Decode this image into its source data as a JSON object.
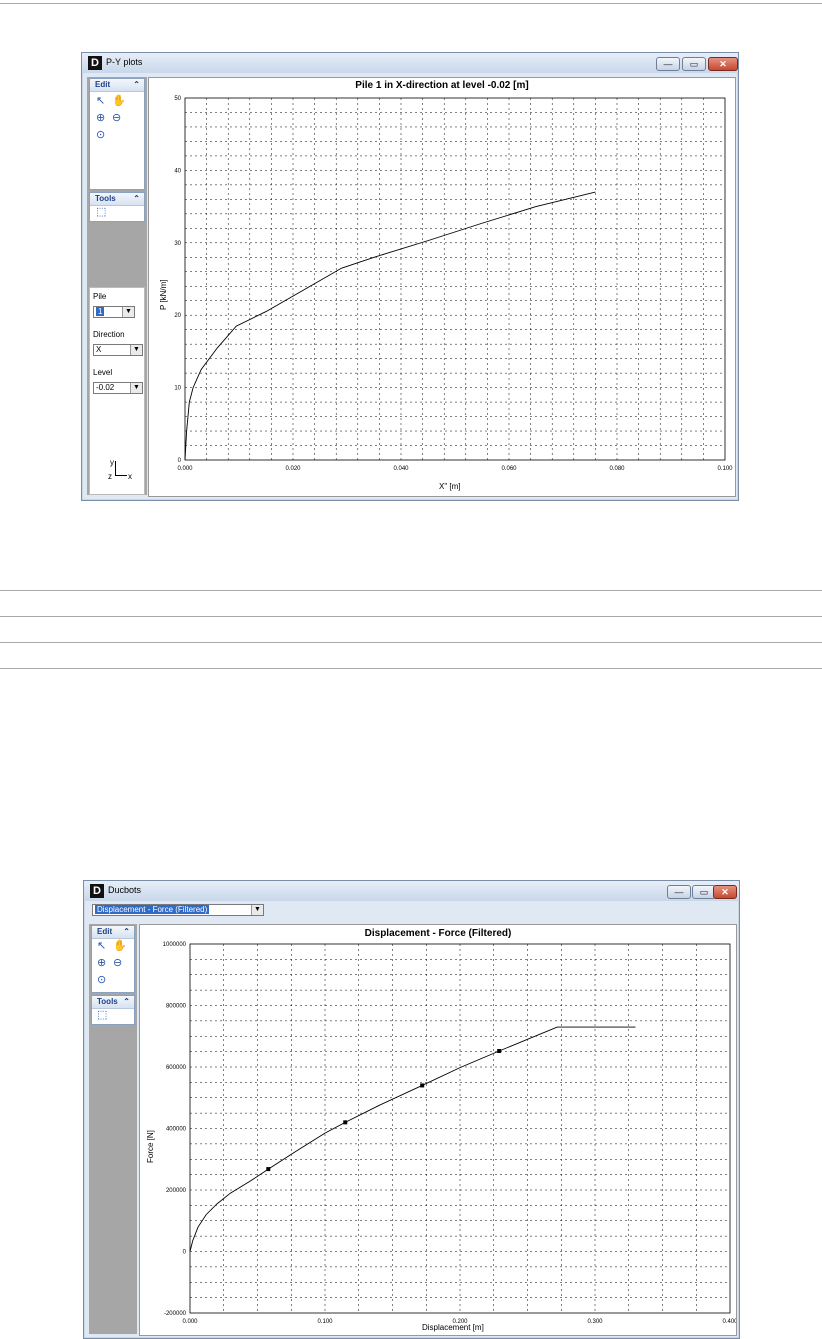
{
  "win1": {
    "title": "P-Y plots",
    "min": "—",
    "max": "▭",
    "close": "✕",
    "edit_label": "Edit",
    "tools_label": "Tools",
    "chevron": "⌃",
    "pile_label": "Pile",
    "pile_value": "1",
    "direction_label": "Direction",
    "direction_value": "X",
    "level_label": "Level",
    "level_value": "-0.02",
    "axes_y": "y",
    "axes_x": "x",
    "axes_z": "z"
  },
  "win2": {
    "title": "Ducbots",
    "min": "—",
    "max": "▭",
    "close": "✕",
    "dropdown_value": "Displacement - Force (Filtered)",
    "edit_label": "Edit",
    "tools_label": "Tools",
    "chevron": "⌃"
  },
  "chart_data": [
    {
      "type": "line",
      "title": "Pile 1 in X-direction at level -0.02 [m]",
      "xlabel": "X\" [m]",
      "ylabel": "P [kN/m]",
      "xlim": [
        0,
        0.1
      ],
      "ylim": [
        0,
        50
      ],
      "x_ticks": [
        "0.000",
        "0.020",
        "0.040",
        "0.060",
        "0.080",
        "0.100"
      ],
      "y_ticks": [
        "0",
        "10",
        "20",
        "30",
        "40",
        "50"
      ],
      "grid": true,
      "series": [
        {
          "x": [
            0,
            0.0003,
            0.0008,
            0.0015,
            0.003,
            0.006,
            0.0095,
            0.015,
            0.022,
            0.029,
            0.035,
            0.045,
            0.055,
            0.065,
            0.076
          ],
          "y": [
            0,
            4,
            8,
            10,
            12.5,
            15.5,
            18.5,
            20.5,
            23.5,
            26.5,
            28,
            30.3,
            32.7,
            35,
            37
          ]
        }
      ]
    },
    {
      "type": "line",
      "title": "Displacement - Force (Filtered)",
      "xlabel": "Displacement [m]",
      "ylabel": "Force [N]",
      "xlim": [
        0,
        0.4
      ],
      "ylim": [
        -200000,
        1000000
      ],
      "x_ticks": [
        "0.000",
        "0.100",
        "0.200",
        "0.300",
        "0.400"
      ],
      "y_ticks": [
        "-200000",
        "0",
        "200000",
        "400000",
        "600000",
        "800000",
        "1000000"
      ],
      "grid": true,
      "series": [
        {
          "x": [
            0,
            0.002,
            0.006,
            0.012,
            0.02,
            0.03,
            0.045,
            0.058,
            0.08,
            0.1,
            0.115,
            0.14,
            0.172,
            0.2,
            0.229,
            0.25,
            0.272,
            0.3,
            0.33
          ],
          "y": [
            0,
            35000,
            80000,
            120000,
            155000,
            190000,
            230000,
            268000,
            330000,
            385000,
            420000,
            475000,
            540000,
            598000,
            652000,
            690000,
            730000,
            730000,
            730000
          ]
        }
      ],
      "markers": {
        "x": [
          0.058,
          0.115,
          0.172,
          0.229
        ],
        "y": [
          268000,
          420000,
          540000,
          652000
        ]
      }
    }
  ]
}
